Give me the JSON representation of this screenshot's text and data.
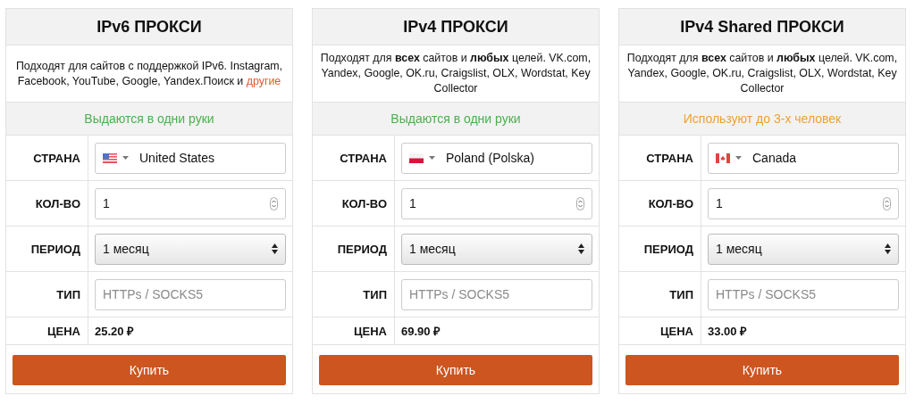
{
  "cards": [
    {
      "title": "IPv6 ПРОКСИ",
      "description": "Подходят для сайтов с поддержкой IPv6. Instagram, Facebook, YouTube, Google, Yandex.Поиск и",
      "link": "другие",
      "note": {
        "kind": "exclusive",
        "text": "Выдаются в одни руки"
      },
      "country_label": "СТРАНА",
      "country": {
        "kind": "us",
        "name": "United States"
      },
      "quantity_label": "КОЛ-ВО",
      "quantity": "1",
      "period_label": "ПЕРИОД",
      "period": "1 месяц",
      "type_label": "ТИП",
      "type_placeholder": "HTTPs / SOCKS5",
      "price_label": "ЦЕНА",
      "price": "25.20 ₽",
      "buy": "Купить"
    },
    {
      "title": "IPv4 ПРОКСИ",
      "description": "Подходят для **всех** сайтов и **любых** целей. VK.com, Yandex, Google, OK.ru, Craigslist, OLX, Wordstat, Key Collector",
      "note": {
        "kind": "exclusive",
        "text": "Выдаются в одни руки"
      },
      "country_label": "СТРАНА",
      "country": {
        "kind": "pl",
        "name": "Poland (Polska)"
      },
      "quantity_label": "КОЛ-ВО",
      "quantity": "1",
      "period_label": "ПЕРИОД",
      "period": "1 месяц",
      "type_label": "ТИП",
      "type_placeholder": "HTTPs / SOCKS5",
      "price_label": "ЦЕНА",
      "price": "69.90 ₽",
      "buy": "Купить"
    },
    {
      "title": "IPv4 Shared ПРОКСИ",
      "description": "Подходят для **всех** сайтов и **любых** целей. VK.com, Yandex, Google, OK.ru, Craigslist, OLX, Wordstat, Key Collector",
      "note": {
        "kind": "shared",
        "text": "Используют до 3-х человек"
      },
      "country_label": "СТРАНА",
      "country": {
        "kind": "ca",
        "name": "Canada"
      },
      "quantity_label": "КОЛ-ВО",
      "quantity": "1",
      "period_label": "ПЕРИОД",
      "period": "1 месяц",
      "type_label": "ТИП",
      "type_placeholder": "HTTPs / SOCKS5",
      "price_label": "ЦЕНА",
      "price": "33.00 ₽",
      "buy": "Купить"
    }
  ]
}
